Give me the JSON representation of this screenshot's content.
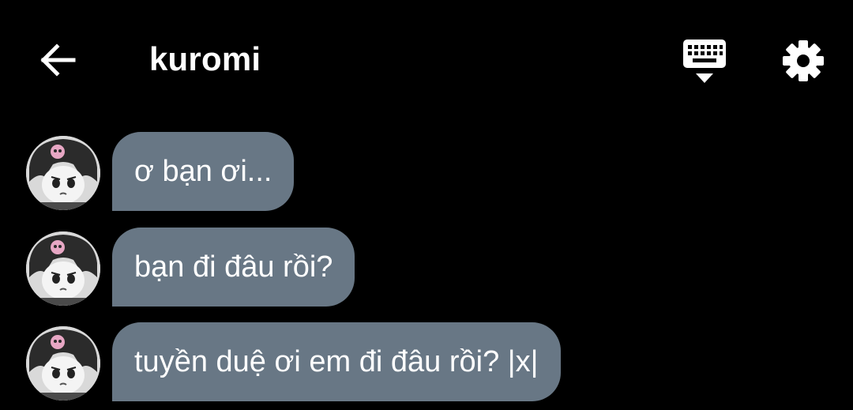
{
  "header": {
    "title": "kuromi",
    "back_icon": "arrow-left-icon",
    "keyboard_icon": "keyboard-hide-icon",
    "settings_icon": "gear-icon"
  },
  "messages": [
    {
      "text": "ơ bạn ơi..."
    },
    {
      "text": "bạn đi đâu rồi?"
    },
    {
      "text": "tuyền duệ ơi em đi đâu rồi? |x|"
    }
  ],
  "colors": {
    "background": "#000000",
    "bubble": "#687785",
    "text": "#ffffff"
  }
}
